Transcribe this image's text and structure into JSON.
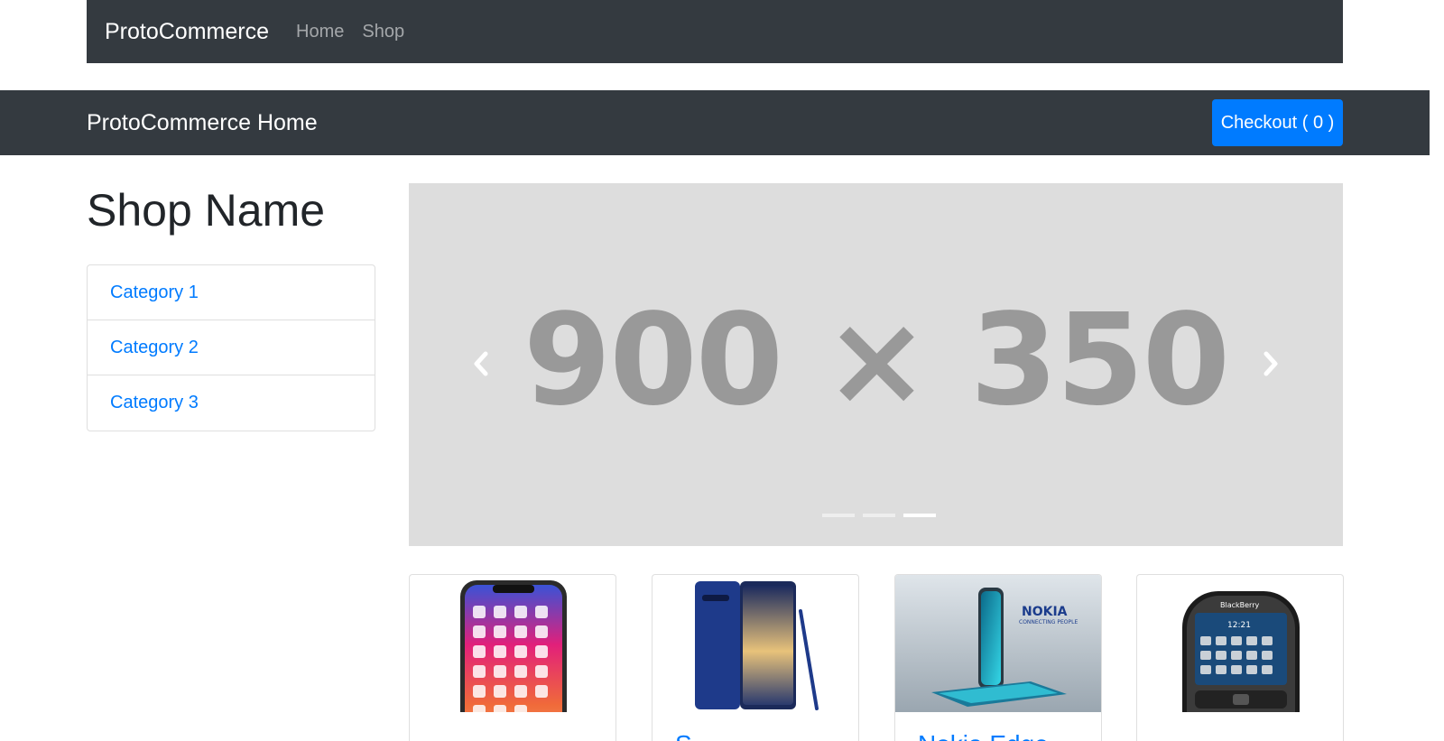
{
  "top_nav": {
    "brand": "ProtoCommerce",
    "links": [
      "Home",
      "Shop"
    ]
  },
  "sub_nav": {
    "title": "ProtoCommerce Home",
    "checkout_label": "Checkout ( 0 )"
  },
  "sidebar": {
    "shop_name": "Shop Name",
    "categories": [
      "Category 1",
      "Category 2",
      "Category 3"
    ]
  },
  "carousel": {
    "placeholder_text": "900 × 350",
    "slide_count": 3,
    "active_slide": 3,
    "prev_icon": "chevron-left-icon",
    "next_icon": "chevron-right-icon"
  },
  "products": [
    {
      "image": "iphone-x-image",
      "title": ""
    },
    {
      "image": "samsung-note-image",
      "title": "S"
    },
    {
      "image": "nokia-edge-image",
      "title": "Nokia Edge"
    },
    {
      "image": "blackberry-image",
      "title": ""
    }
  ],
  "colors": {
    "navbar": "#343a40",
    "primary": "#007bff",
    "carousel_bg": "#dddddd",
    "placeholder_text": "#999999"
  }
}
